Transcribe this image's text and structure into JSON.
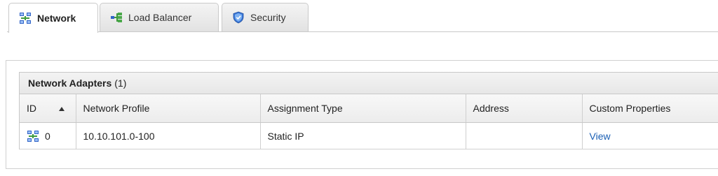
{
  "tabs": [
    {
      "label": "Network",
      "icon": "network-icon",
      "active": true
    },
    {
      "label": "Load Balancer",
      "icon": "load-balancer-icon",
      "active": false
    },
    {
      "label": "Security",
      "icon": "security-shield-icon",
      "active": false
    }
  ],
  "grid": {
    "title_bold": "Network Adapters",
    "title_count": "(1)",
    "columns": [
      "ID",
      "Network Profile",
      "Assignment Type",
      "Address",
      "Custom Properties"
    ],
    "sort": {
      "column": "ID",
      "direction": "ascending"
    },
    "rows": [
      {
        "id": "0",
        "network_profile": "10.10.101.0-100",
        "assignment_type": "Static IP",
        "address": "",
        "custom_properties": "View"
      }
    ]
  },
  "colors": {
    "link": "#1a5fb4",
    "icon_blue": "#2f63c7",
    "icon_green": "#3f9a3f"
  }
}
